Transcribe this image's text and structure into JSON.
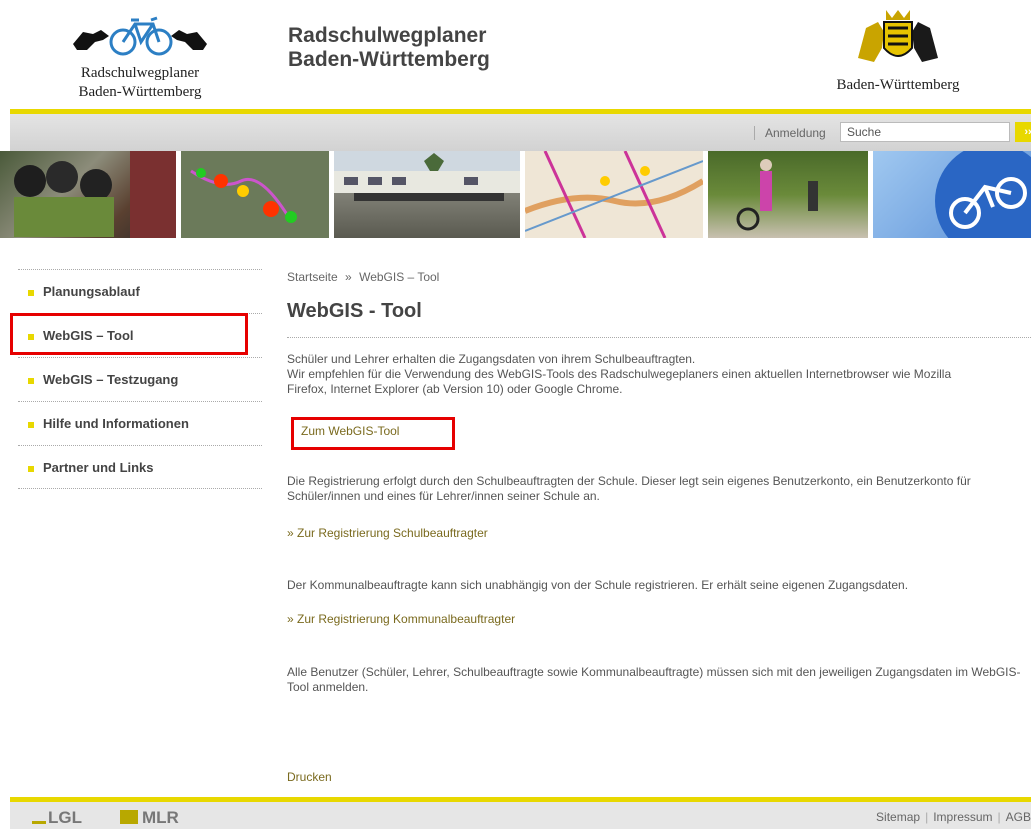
{
  "header": {
    "logo_left_line1": "Radschulwegplaner",
    "logo_left_line2": "Baden-Württemberg",
    "title_line1": "Radschulwegplaner",
    "title_line2": "Baden-Württemberg",
    "logo_right": "Baden-Württemberg"
  },
  "meta_bar": {
    "login": "Anmeldung",
    "search_value": "Suche",
    "search_button": "››"
  },
  "sidebar": {
    "items": [
      {
        "label": "Planungsablauf"
      },
      {
        "label": "WebGIS – Tool"
      },
      {
        "label": "WebGIS – Testzugang"
      },
      {
        "label": "Hilfe und Informationen"
      },
      {
        "label": "Partner und Links"
      }
    ]
  },
  "breadcrumb": {
    "home": "Startseite",
    "separator": "»",
    "current": "WebGIS – Tool"
  },
  "main": {
    "heading": "WebGIS - Tool",
    "intro_line1": "Schüler und Lehrer erhalten die Zugangsdaten von ihrem Schulbeauftragten.",
    "intro_line2": "Wir empfehlen für die Verwendung des WebGIS-Tools des Radschulwegeplaners einen aktuellen Internetbrowser wie Mozilla",
    "intro_line3": "Firefox, Internet Explorer (ab Version 10) oder Google Chrome.",
    "tool_link": "Zum WebGIS-Tool",
    "registration_text": "Die Registrierung erfolgt durch den Schulbeauftragten der Schule. Dieser legt sein eigenes Benutzerkonto, ein Benutzerkonto für Schüler/innen und eines für Lehrer/innen seiner Schule an.",
    "school_reg_link": "» Zur Registrierung Schulbeauftragter",
    "communal_text": "Der Kommunalbeauftragte kann sich unabhängig von der Schule registrieren. Er erhält seine eigenen Zugangsdaten.",
    "communal_reg_link": "» Zur Registrierung Kommunalbeauftragter",
    "all_users_text": "Alle Benutzer (Schüler, Lehrer, Schulbeauftragte sowie Kommunalbeauftragte) müssen sich mit den jeweiligen Zugangsdaten im WebGIS-Tool anmelden.",
    "print_link": "Drucken"
  },
  "footer": {
    "lgl": "LGL",
    "mlr": "MLR",
    "sitemap": "Sitemap",
    "impressum": "Impressum",
    "agb": "AGB",
    "separator": "|"
  },
  "colors": {
    "accent_yellow": "#e8d800",
    "link_brown": "#7a6a1e",
    "highlight_red": "#e60000"
  }
}
